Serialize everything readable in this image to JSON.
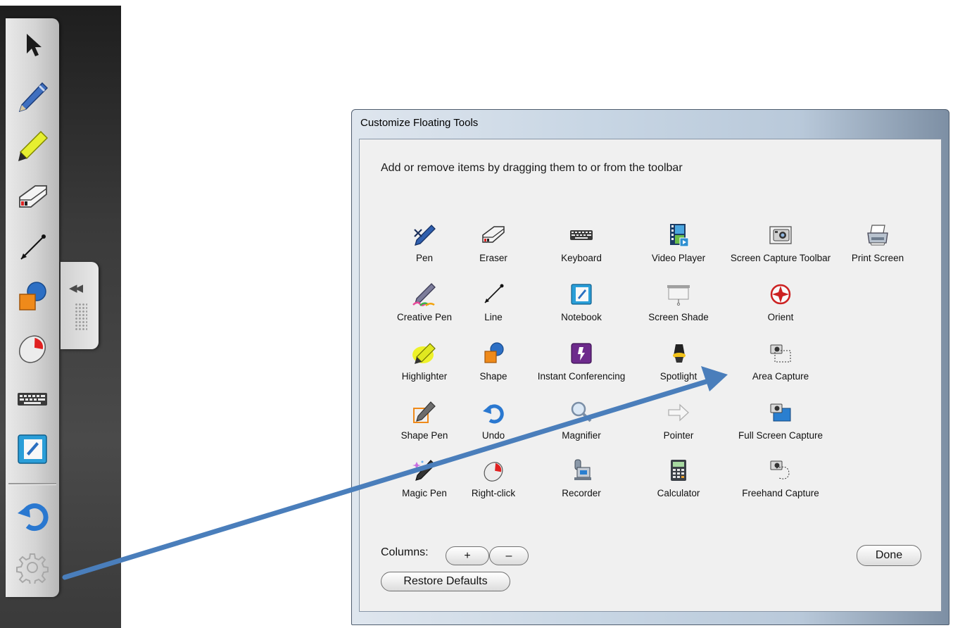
{
  "floating_toolbar": {
    "items": [
      {
        "icon": "select-arrow-icon"
      },
      {
        "icon": "pen-icon"
      },
      {
        "icon": "highlighter-icon"
      },
      {
        "icon": "eraser-icon"
      },
      {
        "icon": "line-icon"
      },
      {
        "icon": "shape-icon"
      },
      {
        "icon": "right-click-icon"
      },
      {
        "icon": "keyboard-icon"
      },
      {
        "icon": "notebook-icon"
      },
      {
        "icon": "undo-icon"
      },
      {
        "icon": "gear-icon"
      }
    ],
    "collapse_glyph": "◀◀"
  },
  "dialog": {
    "title": "Customize Floating Tools",
    "instructions": "Add or remove items by dragging them to or from the toolbar",
    "tools": [
      {
        "label": "Pen",
        "icon": "pen-icon"
      },
      {
        "label": "Eraser",
        "icon": "eraser-icon"
      },
      {
        "label": "Keyboard",
        "icon": "keyboard-icon"
      },
      {
        "label": "Video Player",
        "icon": "video-player-icon"
      },
      {
        "label": "Screen Capture Toolbar",
        "icon": "camera-icon"
      },
      {
        "label": "Print Screen",
        "icon": "printer-icon"
      },
      {
        "label": "Creative Pen",
        "icon": "creative-pen-icon"
      },
      {
        "label": "Line",
        "icon": "line-icon"
      },
      {
        "label": "Notebook",
        "icon": "notebook-icon"
      },
      {
        "label": "Screen Shade",
        "icon": "screen-shade-icon"
      },
      {
        "label": "Orient",
        "icon": "orient-icon"
      },
      {
        "label": "Highlighter",
        "icon": "highlighter-icon"
      },
      {
        "label": "Shape",
        "icon": "shape-icon"
      },
      {
        "label": "Instant Conferencing",
        "icon": "conferencing-icon"
      },
      {
        "label": "Spotlight",
        "icon": "spotlight-icon"
      },
      {
        "label": "Area Capture",
        "icon": "area-capture-icon"
      },
      {
        "label": "Shape Pen",
        "icon": "shape-pen-icon"
      },
      {
        "label": "Undo",
        "icon": "undo-icon"
      },
      {
        "label": "Magnifier",
        "icon": "magnifier-icon"
      },
      {
        "label": "Pointer",
        "icon": "pointer-arrow-icon"
      },
      {
        "label": "Full Screen Capture",
        "icon": "full-screen-capture-icon"
      },
      {
        "label": "Magic Pen",
        "icon": "magic-pen-icon"
      },
      {
        "label": "Right-click",
        "icon": "right-click-icon"
      },
      {
        "label": "Recorder",
        "icon": "recorder-icon"
      },
      {
        "label": "Calculator",
        "icon": "calculator-icon"
      },
      {
        "label": "Freehand Capture",
        "icon": "freehand-capture-icon"
      }
    ],
    "columns_label": "Columns:",
    "columns_add": "+",
    "columns_remove": "–",
    "restore_defaults": "Restore Defaults",
    "done": "Done"
  },
  "colors": {
    "annotation_arrow": "#4a7ebb"
  }
}
